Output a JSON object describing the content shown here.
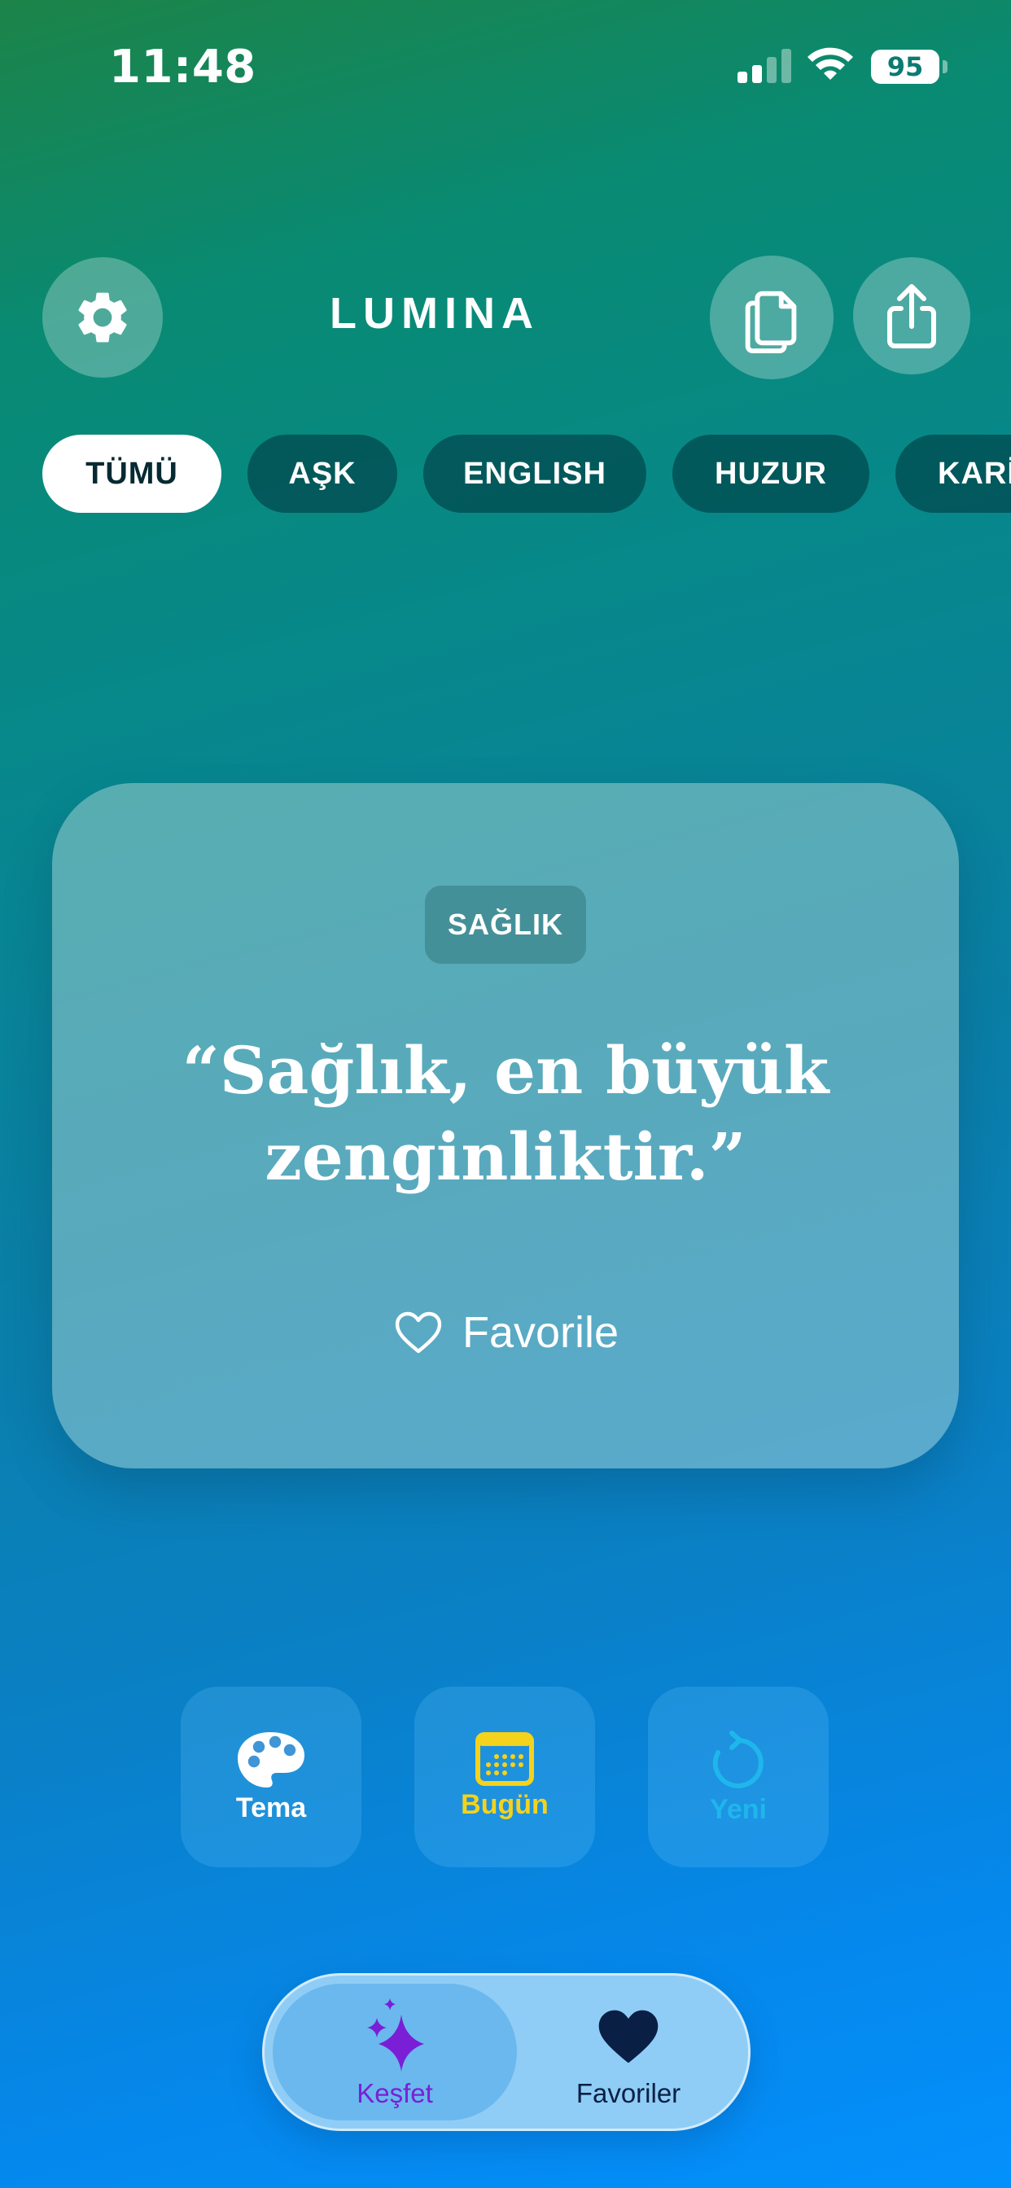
{
  "status_bar": {
    "time": "11:48",
    "battery": "95",
    "icons": [
      "signal-icon",
      "wifi-icon",
      "battery-icon"
    ]
  },
  "header": {
    "title": "LUMINA",
    "icons": [
      "gear-icon",
      "copy-icon",
      "share-icon"
    ]
  },
  "categories": [
    {
      "label": "TÜMÜ",
      "active": true
    },
    {
      "label": "AŞK",
      "active": false
    },
    {
      "label": "ENGLISH",
      "active": false
    },
    {
      "label": "HUZUR",
      "active": false
    },
    {
      "label": "KARİYER",
      "active": false
    }
  ],
  "card": {
    "category": "SAĞLIK",
    "quote": "“Sağlık, en büyük zenginliktir.”",
    "favorite_label": "Favorile",
    "favorite_icon": "heart-outline-icon"
  },
  "actions": [
    {
      "label": "Tema",
      "icon": "palette-icon",
      "color": "#ffffff"
    },
    {
      "label": "Bugün",
      "icon": "calendar-icon",
      "color": "#f5d21c"
    },
    {
      "label": "Yeni",
      "icon": "refresh-icon",
      "color": "#1fb6ec"
    }
  ],
  "tabbar": {
    "tabs": [
      {
        "label": "Keşfet",
        "icon": "sparkles-icon",
        "active": true,
        "color": "#7a1fd6"
      },
      {
        "label": "Favoriler",
        "icon": "heart-filled-icon",
        "active": false,
        "color": "#0a1f44"
      }
    ]
  }
}
